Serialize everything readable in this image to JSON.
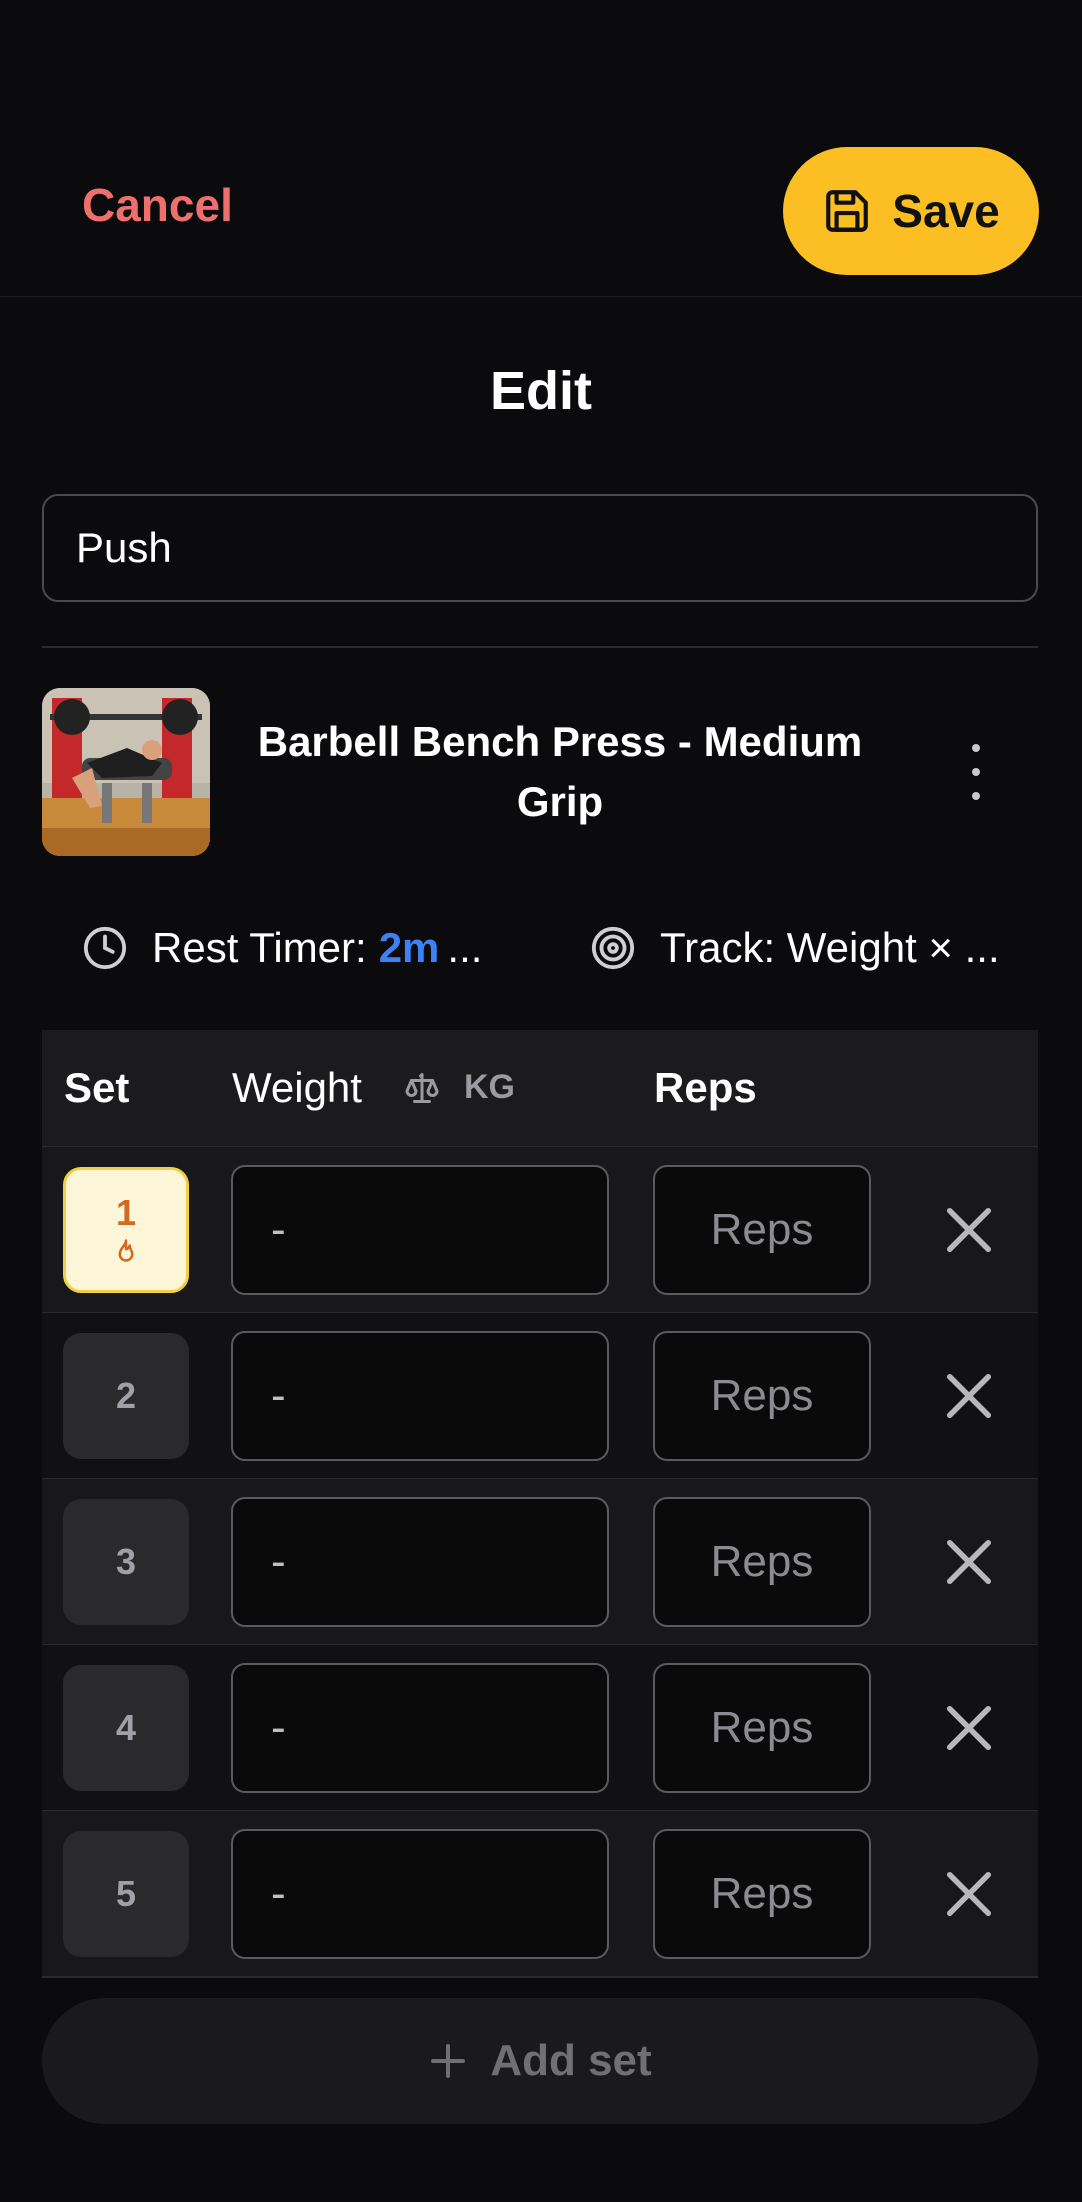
{
  "header": {
    "cancel_label": "Cancel",
    "save_label": "Save",
    "save_icon": "floppy-disk-icon",
    "save_color": "#fbbf24",
    "cancel_color": "#ee6f6b"
  },
  "title": "Edit",
  "workout_name": "Push",
  "exercise": {
    "name": "Barbell Bench Press - Medium Grip",
    "thumbnail_icon": "bench-press-photo",
    "more_icon": "kebab-menu-icon",
    "rest_timer_label": "Rest Timer:",
    "rest_timer_value": "2m",
    "rest_timer_ellipsis": "...",
    "track_label": "Track: Weight × ...",
    "accent_color": "#3b82f6"
  },
  "table": {
    "col_set": "Set",
    "col_weight": "Weight",
    "col_unit": "KG",
    "col_reps": "Reps",
    "rows": [
      {
        "set": "1",
        "weight_placeholder": "-",
        "reps_placeholder": "Reps",
        "type": "warmup"
      },
      {
        "set": "2",
        "weight_placeholder": "-",
        "reps_placeholder": "Reps",
        "type": "normal"
      },
      {
        "set": "3",
        "weight_placeholder": "-",
        "reps_placeholder": "Reps",
        "type": "normal"
      },
      {
        "set": "4",
        "weight_placeholder": "-",
        "reps_placeholder": "Reps",
        "type": "normal"
      },
      {
        "set": "5",
        "weight_placeholder": "-",
        "reps_placeholder": "Reps",
        "type": "normal"
      }
    ]
  },
  "add_set_label": "Add set"
}
